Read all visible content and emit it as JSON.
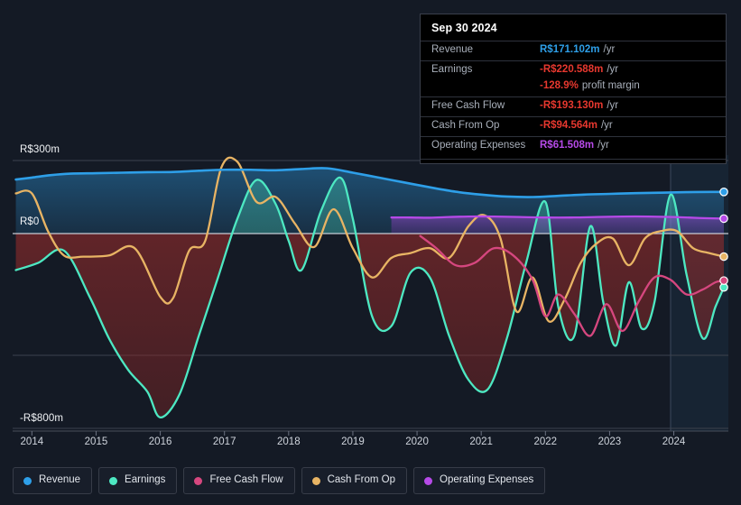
{
  "axes": {
    "y_top_label": "R$300m",
    "y_zero_label": "R$0",
    "y_bottom_label": "-R$800m",
    "x_ticks": [
      "2014",
      "2015",
      "2016",
      "2017",
      "2018",
      "2019",
      "2020",
      "2021",
      "2022",
      "2023",
      "2024"
    ]
  },
  "tooltip": {
    "date": "Sep 30 2024",
    "rows": [
      {
        "key": "Revenue",
        "value": "R$171.102m",
        "unit": "/yr",
        "color": "#2e9fe8"
      },
      {
        "key": "Earnings",
        "value": "-R$220.588m",
        "unit": "/yr",
        "color": "#e8382f"
      },
      {
        "key": "",
        "value": "-128.9%",
        "unit": "profit margin",
        "color": "#e8382f"
      },
      {
        "key": "Free Cash Flow",
        "value": "-R$193.130m",
        "unit": "/yr",
        "color": "#e8382f"
      },
      {
        "key": "Cash From Op",
        "value": "-R$94.564m",
        "unit": "/yr",
        "color": "#e8382f"
      },
      {
        "key": "Operating Expenses",
        "value": "R$61.508m",
        "unit": "/yr",
        "color": "#b64ae8"
      }
    ]
  },
  "legend": {
    "items": [
      {
        "label": "Revenue",
        "color": "#2e9fe8"
      },
      {
        "label": "Earnings",
        "color": "#4de8c2"
      },
      {
        "label": "Free Cash Flow",
        "color": "#d6477f"
      },
      {
        "label": "Cash From Op",
        "color": "#e8b464"
      },
      {
        "label": "Operating Expenses",
        "color": "#b64ae8"
      }
    ]
  },
  "chart_data": {
    "type": "line",
    "title": "",
    "xlabel": "",
    "ylabel": "",
    "ylim": [
      -800,
      300
    ],
    "xlim": [
      2013.7,
      2024.85
    ],
    "grid": true,
    "zero_line": 0,
    "currency": "R$",
    "units": "millions per year",
    "legend_position": "bottom-left",
    "forecast_region_start": 2023.95,
    "annotations": [
      {
        "type": "hover-tooltip",
        "date": "Sep 30 2024"
      }
    ],
    "axis_gridlines_y": [
      300,
      0,
      -500,
      -800
    ],
    "series": [
      {
        "name": "Revenue",
        "color": "#2e9fe8",
        "filled": true,
        "x": [
          2013.75,
          2014.0,
          2014.3,
          2014.6,
          2015.0,
          2015.4,
          2015.8,
          2016.2,
          2016.6,
          2017.0,
          2017.4,
          2017.8,
          2018.2,
          2018.6,
          2019.0,
          2019.4,
          2019.8,
          2020.2,
          2020.6,
          2021.0,
          2021.4,
          2021.8,
          2022.2,
          2022.6,
          2023.0,
          2023.4,
          2023.8,
          2024.2,
          2024.6,
          2024.78
        ],
        "values": [
          222,
          230,
          240,
          246,
          248,
          250,
          252,
          253,
          258,
          262,
          262,
          260,
          265,
          268,
          250,
          230,
          210,
          190,
          172,
          160,
          152,
          150,
          155,
          160,
          163,
          166,
          168,
          170,
          171,
          171.102
        ]
      },
      {
        "name": "Earnings",
        "color": "#4de8c2",
        "filled": true,
        "x": [
          2013.75,
          2014.1,
          2014.5,
          2014.9,
          2015.2,
          2015.5,
          2015.8,
          2016.0,
          2016.3,
          2016.6,
          2016.9,
          2017.2,
          2017.5,
          2017.8,
          2018.0,
          2018.2,
          2018.5,
          2018.8,
          2019.0,
          2019.3,
          2019.6,
          2019.9,
          2020.2,
          2020.5,
          2020.8,
          2021.1,
          2021.4,
          2021.7,
          2022.0,
          2022.2,
          2022.45,
          2022.7,
          2022.9,
          2023.1,
          2023.3,
          2023.5,
          2023.7,
          2023.95,
          2024.2,
          2024.45,
          2024.65,
          2024.78
        ],
        "values": [
          -150,
          -120,
          -70,
          -260,
          -430,
          -560,
          -650,
          -755,
          -660,
          -420,
          -180,
          60,
          220,
          120,
          -30,
          -150,
          90,
          230,
          60,
          -340,
          -380,
          -160,
          -180,
          -420,
          -600,
          -640,
          -430,
          -120,
          130,
          -300,
          -420,
          30,
          -280,
          -460,
          -200,
          -390,
          -280,
          160,
          -170,
          -430,
          -300,
          -221
        ]
      },
      {
        "name": "Free Cash Flow",
        "color": "#d6477f",
        "filled": false,
        "x": [
          2020.05,
          2020.3,
          2020.6,
          2020.9,
          2021.2,
          2021.5,
          2021.8,
          2022.0,
          2022.2,
          2022.45,
          2022.7,
          2022.95,
          2023.2,
          2023.45,
          2023.7,
          2023.95,
          2024.2,
          2024.45,
          2024.65,
          2024.78
        ],
        "values": [
          -10,
          -60,
          -130,
          -120,
          -60,
          -90,
          -190,
          -340,
          -250,
          -330,
          -420,
          -290,
          -400,
          -280,
          -180,
          -190,
          -250,
          -230,
          -200,
          -193.13
        ]
      },
      {
        "name": "Cash From Op",
        "color": "#e8b464",
        "filled": false,
        "x": [
          2013.75,
          2014.0,
          2014.25,
          2014.5,
          2014.8,
          2015.2,
          2015.6,
          2016.0,
          2016.2,
          2016.45,
          2016.7,
          2016.95,
          2017.2,
          2017.5,
          2017.8,
          2018.1,
          2018.4,
          2018.7,
          2019.0,
          2019.3,
          2019.6,
          2019.9,
          2020.2,
          2020.5,
          2020.8,
          2021.05,
          2021.3,
          2021.55,
          2021.8,
          2022.05,
          2022.3,
          2022.55,
          2022.8,
          2023.05,
          2023.3,
          2023.55,
          2023.8,
          2024.05,
          2024.3,
          2024.55,
          2024.78
        ],
        "values": [
          165,
          165,
          10,
          -90,
          -95,
          -90,
          -60,
          -260,
          -265,
          -70,
          -30,
          270,
          295,
          130,
          150,
          40,
          -55,
          100,
          -60,
          -180,
          -100,
          -80,
          -60,
          -100,
          30,
          75,
          -20,
          -320,
          -180,
          -360,
          -270,
          -120,
          -40,
          -20,
          -130,
          -20,
          10,
          10,
          -60,
          -80,
          -94.564
        ]
      },
      {
        "name": "Operating Expenses",
        "color": "#b64ae8",
        "filled": true,
        "x": [
          2019.6,
          2019.9,
          2020.2,
          2020.5,
          2020.8,
          2021.2,
          2021.6,
          2022.0,
          2022.4,
          2022.8,
          2023.2,
          2023.6,
          2024.0,
          2024.4,
          2024.78
        ],
        "values": [
          66,
          66,
          65,
          68,
          70,
          70,
          68,
          66,
          66,
          68,
          70,
          70,
          68,
          64,
          61.508
        ]
      }
    ]
  }
}
